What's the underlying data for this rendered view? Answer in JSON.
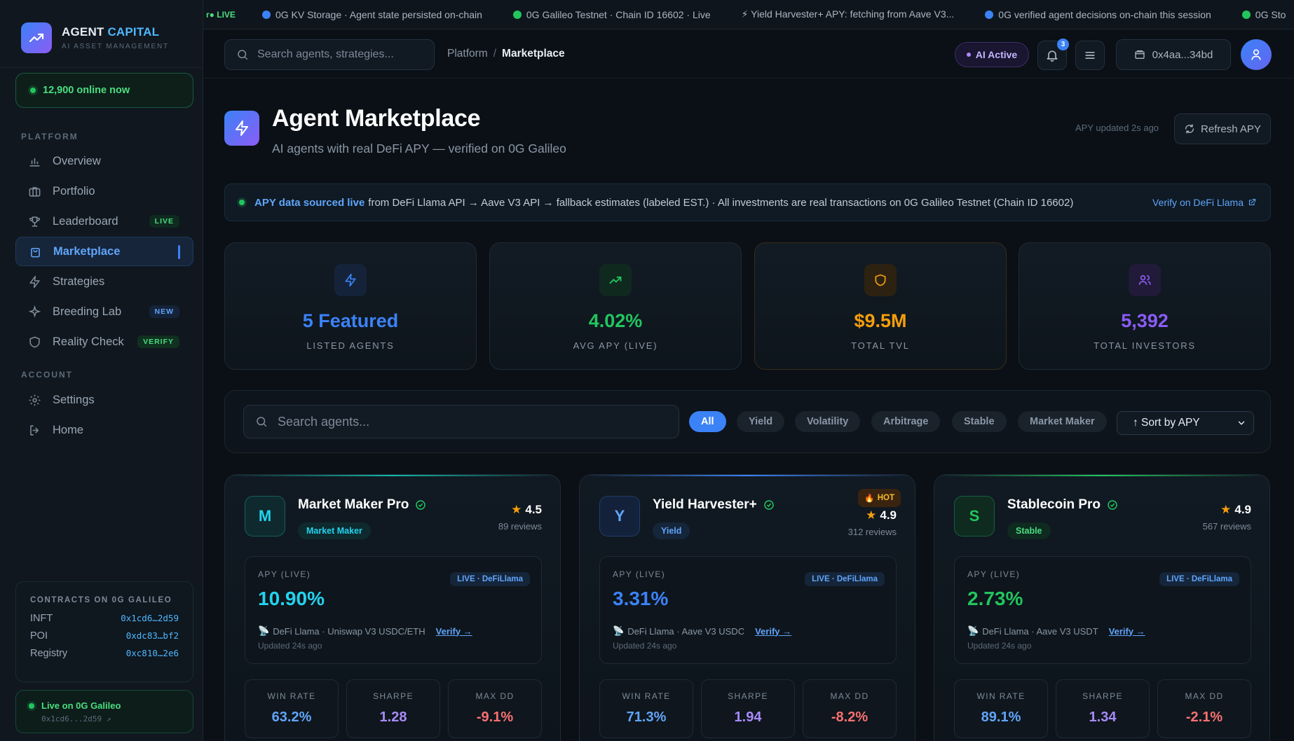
{
  "brand": {
    "title_a": "AGENT ",
    "title_b": "CAPITAL",
    "subtitle": "AI ASSET MANAGEMENT"
  },
  "online": {
    "text": "12,900 online now"
  },
  "sidebar": {
    "platform_heading": "PLATFORM",
    "account_heading": "ACCOUNT",
    "items": [
      {
        "label": "Overview",
        "icon": "bar-chart-icon"
      },
      {
        "label": "Portfolio",
        "icon": "briefcase-icon"
      },
      {
        "label": "Leaderboard",
        "icon": "trophy-icon",
        "badge": "LIVE"
      },
      {
        "label": "Marketplace",
        "icon": "shopping-bag-icon",
        "active": true
      },
      {
        "label": "Strategies",
        "icon": "zap-icon"
      },
      {
        "label": "Breeding Lab",
        "icon": "sparkle-icon",
        "badge": "NEW"
      },
      {
        "label": "Reality Check",
        "icon": "shield-icon",
        "badge": "VERIFY"
      }
    ],
    "account_items": [
      {
        "label": "Settings",
        "icon": "gear-icon"
      },
      {
        "label": "Home",
        "icon": "logout-icon"
      }
    ]
  },
  "contracts": {
    "title": "CONTRACTS ON 0G GALILEO",
    "rows": [
      {
        "name": "INFT",
        "addr": "0x1cd6…2d59"
      },
      {
        "name": "POI",
        "addr": "0xdc83…bf2"
      },
      {
        "name": "Registry",
        "addr": "0xc810…2e6"
      }
    ]
  },
  "live_box": {
    "title": "Live on 0G Galileo",
    "addr": "0x1cd6...2d59 ↗"
  },
  "ticker": {
    "live_label": "r● LIVE",
    "items": [
      {
        "text": "0G KV Storage · Agent state persisted on-chain",
        "color": "#3b82f6"
      },
      {
        "text": "0G Galileo Testnet · Chain ID 16602 · Live",
        "color": "#22c55e"
      },
      {
        "text": "⚡ Yield Harvester+ APY: fetching from Aave V3...",
        "color": ""
      },
      {
        "text": "0G verified agent decisions on-chain this session",
        "color": "#3b82f6"
      },
      {
        "text": "0G Sto",
        "color": "#22c55e"
      }
    ]
  },
  "topbar": {
    "search_placeholder": "Search agents, strategies...",
    "breadcrumb_root": "Platform",
    "breadcrumb_sep": "/",
    "breadcrumb_current": "Marketplace",
    "ai_status": "AI Active",
    "notification_count": "3",
    "wallet": "0x4aa...34bd"
  },
  "header": {
    "title": "Agent Marketplace",
    "subtitle": "AI agents with real DeFi APY — verified on 0G Galileo",
    "apy_updated": "APY updated 2s ago",
    "refresh_label": "Refresh APY"
  },
  "banner": {
    "highlight": "APY data sourced live",
    "text": "from DeFi Llama API → Aave V3 API → fallback estimates (labeled EST.) · All investments are real transactions on 0G Galileo Testnet (Chain ID 16602)",
    "link": "Verify on DeFi Llama"
  },
  "stats": [
    {
      "value": "5 Featured",
      "label": "LISTED AGENTS",
      "color": "#3b82f6",
      "icon": "zap-icon"
    },
    {
      "value": "4.02%",
      "label": "AVG APY (LIVE)",
      "color": "#22c55e",
      "icon": "trending-up-icon"
    },
    {
      "value": "$9.5M",
      "label": "TOTAL TVL",
      "color": "#f59e0b",
      "icon": "shield-icon"
    },
    {
      "value": "5,392",
      "label": "TOTAL INVESTORS",
      "color": "#8b5cf6",
      "icon": "users-icon"
    }
  ],
  "filters": {
    "search_placeholder": "Search agents...",
    "chips": [
      "All",
      "Yield",
      "Volatility",
      "Arbitrage",
      "Stable",
      "Market Maker"
    ],
    "active_chip": "All",
    "sort_label": "↑ Sort by APY"
  },
  "agents": [
    {
      "initial": "M",
      "name": "Market Maker Pro",
      "tag": "Market Maker",
      "rating": "4.5",
      "reviews": "89 reviews",
      "hot": "",
      "apy_label": "APY (LIVE)",
      "live_badge": "LIVE · DeFiLlama",
      "apy": "10.90%",
      "source": "DeFi Llama · Uniswap V3 USDC/ETH",
      "verify": "Verify →",
      "updated": "Updated 24s ago",
      "win_rate": "63.2%",
      "sharpe": "1.28",
      "max_dd": "-9.1%",
      "accent": "#22d3ee"
    },
    {
      "initial": "Y",
      "name": "Yield Harvester+",
      "tag": "Yield",
      "rating": "4.9",
      "reviews": "312 reviews",
      "hot": "HOT",
      "apy_label": "APY (LIVE)",
      "live_badge": "LIVE · DeFiLlama",
      "apy": "3.31%",
      "source": "DeFi Llama · Aave V3 USDC",
      "verify": "Verify →",
      "updated": "Updated 24s ago",
      "win_rate": "71.3%",
      "sharpe": "1.94",
      "max_dd": "-8.2%",
      "accent": "#3b82f6"
    },
    {
      "initial": "S",
      "name": "Stablecoin Pro",
      "tag": "Stable",
      "rating": "4.9",
      "reviews": "567 reviews",
      "hot": "",
      "apy_label": "APY (LIVE)",
      "live_badge": "LIVE · DeFiLlama",
      "apy": "2.73%",
      "source": "DeFi Llama · Aave V3 USDT",
      "verify": "Verify →",
      "updated": "Updated 24s ago",
      "win_rate": "89.1%",
      "sharpe": "1.34",
      "max_dd": "-2.1%",
      "accent": "#22c55e"
    }
  ],
  "metric_labels": {
    "win_rate": "WIN RATE",
    "sharpe": "SHARPE",
    "max_dd": "MAX DD"
  }
}
